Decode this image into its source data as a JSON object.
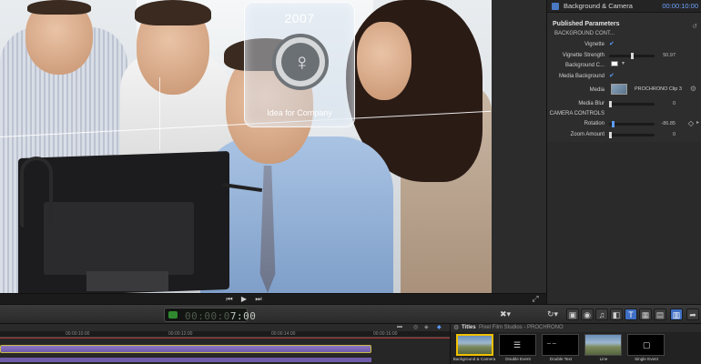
{
  "viewer": {
    "card_year": "2007",
    "card_title": "Idea for Company",
    "card_icon": "microphone-icon",
    "transport": {
      "prev": "⏮",
      "play": "▶",
      "next": "⏭"
    }
  },
  "inspector": {
    "title": "Background & Camera",
    "timecode": "00:00:10:00",
    "section": "Published Parameters",
    "rows": {
      "background_controls": "BACKGROUND CONT...",
      "vignette": "Vignette",
      "vignette_strength": "Vignette Strength",
      "vignette_strength_value": "50.97",
      "background_color": "Background C...",
      "media_background": "Media Background",
      "media": "Media",
      "media_name": "PROCHRONO Clip 3",
      "media_blur": "Media Blur",
      "media_blur_value": "0",
      "camera_controls": "CAMERA CONTROLS",
      "rotation": "Rotation",
      "rotation_value": "-86.85",
      "zoom_amount": "Zoom Amount",
      "zoom_amount_value": "0"
    }
  },
  "toolbar": {
    "timecode_dim": "00:00:0",
    "timecode_lit": "7:00"
  },
  "timeline": {
    "ticks": [
      "00:00:10:00",
      "00:00:12:00",
      "00:00:14:00",
      "00:00:16:00"
    ]
  },
  "browser": {
    "title": "Titles",
    "path": "Pixel Film Studios - PROCHRONO",
    "items": [
      {
        "label": "Background & Camera"
      },
      {
        "label": "Double Event"
      },
      {
        "label": "Double Text"
      },
      {
        "label": "Line"
      },
      {
        "label": "Single Event"
      }
    ]
  },
  "colors": {
    "accent": "#3f6fc4",
    "selection": "#f0c000",
    "timecode_green": "#2f8a2f",
    "clip_purple": "#6e5aa8"
  }
}
